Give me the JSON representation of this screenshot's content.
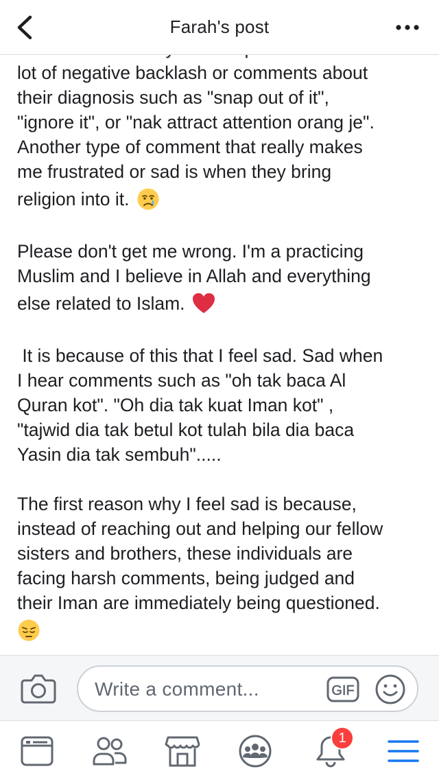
{
  "header": {
    "title": "Farah's post",
    "back_icon": "chevron-left-icon",
    "more_icon": "more-horizontal-icon"
  },
  "post": {
    "lines": [
      "who admit that they have depression face a",
      "lot of negative backlash or comments about",
      "their diagnosis such as \"snap out of it\",",
      "\"ignore it\", or \"nak attract attention orang je\".",
      "Another type of comment that really makes",
      "me frustrated or sad is when they bring",
      "religion into it.",
      "Please don't get me wrong. I'm a practicing",
      "Muslim and I believe in Allah and everything",
      "else related to Islam.",
      " It is because of this that I feel sad. Sad when",
      "I hear comments such as \"oh tak baca Al",
      "Quran kot\". \"Oh dia tak kuat Iman kot\" ,",
      "\"tajwid dia tak betul kot tulah bila dia baca",
      "Yasin dia tak sembuh\".....",
      "The first reason why I feel sad is because,",
      "instead of reaching out and helping our fellow",
      "sisters and brothers, these individuals are",
      "facing harsh comments, being judged and",
      "their Iman are immediately being questioned."
    ],
    "emojis": [
      "crying-face-emoji",
      "red-heart-emoji",
      "pensive-face-emoji"
    ]
  },
  "comment_bar": {
    "placeholder": "Write a comment...",
    "gif_label": "GIF",
    "camera_icon": "camera-icon",
    "sticker_icon": "smiley-icon"
  },
  "bottom_nav": {
    "items": [
      "news-feed-icon",
      "friends-icon",
      "marketplace-icon",
      "groups-icon",
      "notifications-icon",
      "menu-icon"
    ],
    "notification_count": "1"
  },
  "colors": {
    "text": "#1c1e21",
    "icon_gray": "#606770",
    "accent_blue": "#1877f2",
    "badge_red": "#fa3e3e"
  }
}
